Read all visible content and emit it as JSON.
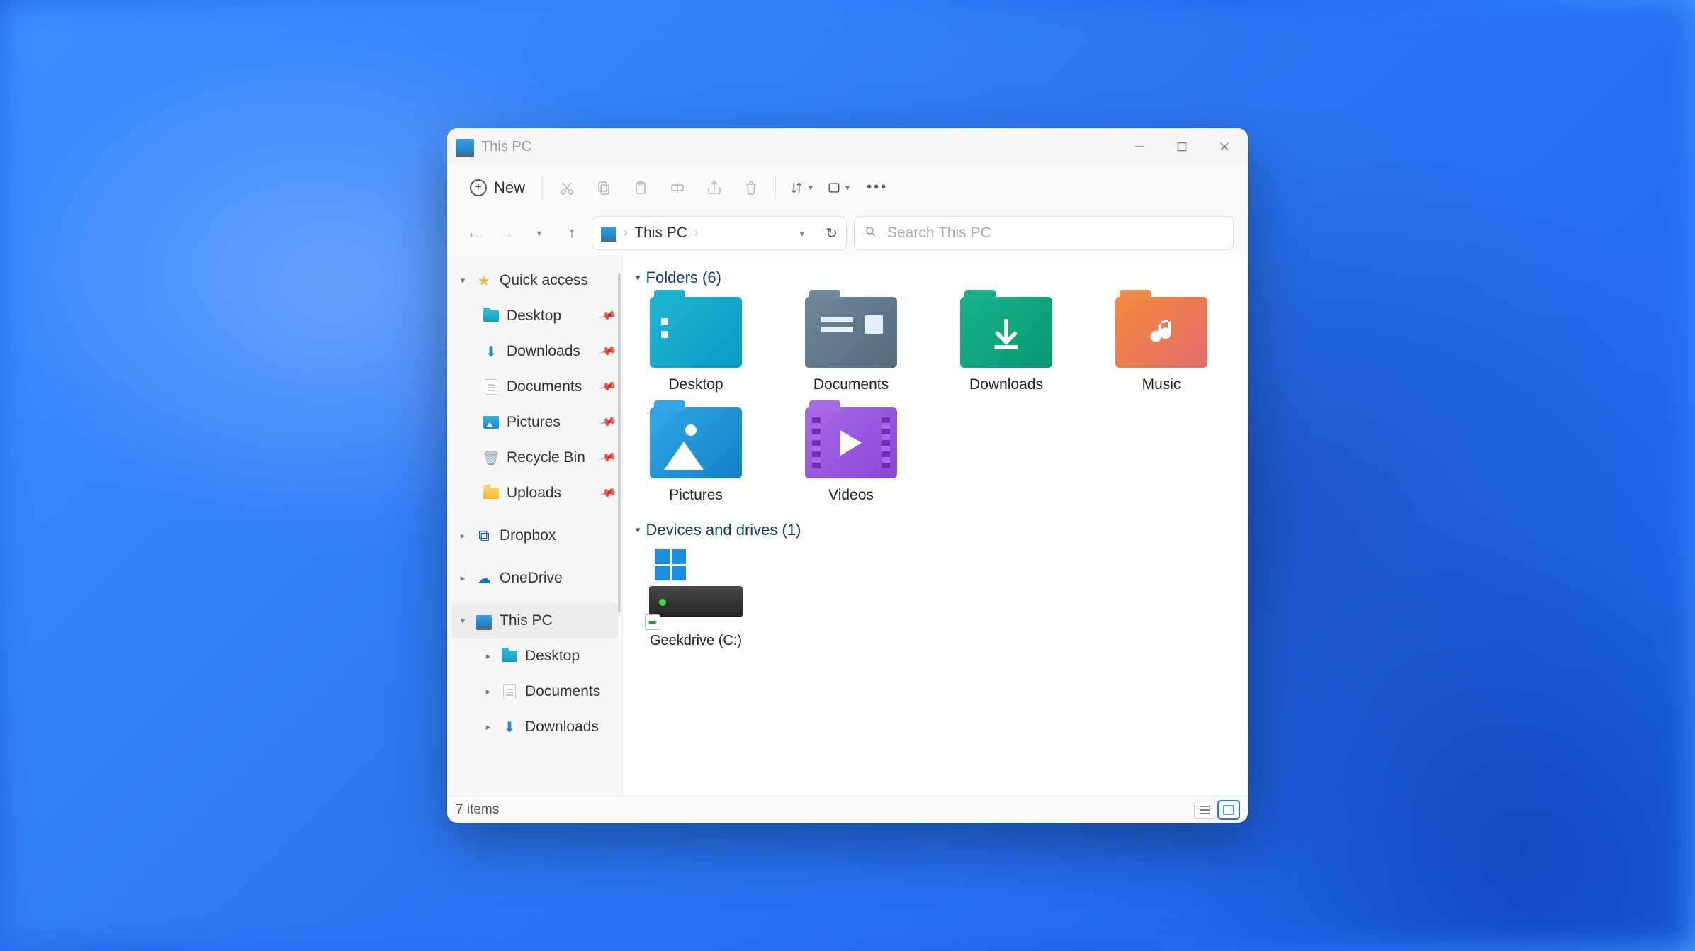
{
  "window": {
    "title": "This PC"
  },
  "toolbar": {
    "new_label": "New",
    "icons": {
      "cut": "cut-icon",
      "copy": "copy-icon",
      "paste": "paste-icon",
      "rename": "rename-icon",
      "share": "share-icon",
      "delete": "delete-icon",
      "sort": "sort-icon",
      "view": "view-icon",
      "more": "more-icon"
    }
  },
  "address": {
    "location": "This PC"
  },
  "search": {
    "placeholder": "Search This PC"
  },
  "sidebar": {
    "quick_access": {
      "label": "Quick access",
      "items": [
        {
          "label": "Desktop",
          "pinned": true
        },
        {
          "label": "Downloads",
          "pinned": true
        },
        {
          "label": "Documents",
          "pinned": true
        },
        {
          "label": "Pictures",
          "pinned": true
        },
        {
          "label": "Recycle Bin",
          "pinned": true
        },
        {
          "label": "Uploads",
          "pinned": true
        }
      ]
    },
    "dropbox": {
      "label": "Dropbox"
    },
    "onedrive": {
      "label": "OneDrive"
    },
    "this_pc": {
      "label": "This PC",
      "children": [
        {
          "label": "Desktop"
        },
        {
          "label": "Documents"
        },
        {
          "label": "Downloads"
        }
      ]
    }
  },
  "content": {
    "folders_header": "Folders (6)",
    "folders": [
      {
        "label": "Desktop"
      },
      {
        "label": "Documents"
      },
      {
        "label": "Downloads"
      },
      {
        "label": "Music"
      },
      {
        "label": "Pictures"
      },
      {
        "label": "Videos"
      }
    ],
    "drives_header": "Devices and drives (1)",
    "drives": [
      {
        "label": "Geekdrive (C:)"
      }
    ]
  },
  "status": {
    "items": "7 items"
  }
}
